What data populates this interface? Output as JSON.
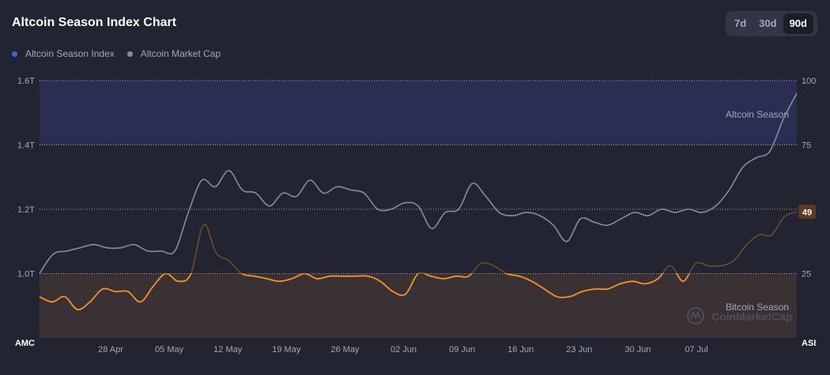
{
  "header": {
    "title": "Altcoin Season Index Chart"
  },
  "range_options": [
    {
      "label": "7d",
      "active": false
    },
    {
      "label": "30d",
      "active": false
    },
    {
      "label": "90d",
      "active": true
    }
  ],
  "legend": [
    {
      "label": "Altcoin Season Index",
      "color": "#3861fb"
    },
    {
      "label": "Altcoin Market Cap",
      "color": "#858ca2"
    }
  ],
  "watermark": "CoinMarketCap",
  "chart_data": {
    "type": "line",
    "x_ticks": [
      "28 Apr",
      "05 May",
      "12 May",
      "19 May",
      "26 May",
      "02 Jun",
      "09 Jun",
      "16 Jun",
      "23 Jun",
      "30 Jun",
      "07 Jul"
    ],
    "left_axis": {
      "label": "AMC",
      "ticks": [
        "1.0T",
        "1.2T",
        "1.4T",
        "1.6T"
      ],
      "tick_values": [
        1.0,
        1.2,
        1.4,
        1.6
      ],
      "unit": "T",
      "ylim": [
        0.8,
        1.6
      ]
    },
    "right_axis": {
      "label": "ASI",
      "ticks": [
        "25",
        "50",
        "75",
        "100"
      ],
      "tick_values": [
        25,
        50,
        75,
        100
      ],
      "ylim": [
        0,
        100
      ]
    },
    "zones": [
      {
        "label": "Altcoin Season",
        "from": 75,
        "to": 100,
        "color": "#2b2e52"
      },
      {
        "label": "Bitcoin Season",
        "from": 0,
        "to": 25,
        "color": "#3a3135"
      }
    ],
    "current_value": "49",
    "series": [
      {
        "name": "Altcoin Market Cap",
        "axis": "left",
        "color": "#858ca2",
        "values": [
          1.0,
          1.06,
          1.07,
          1.08,
          1.09,
          1.08,
          1.08,
          1.09,
          1.07,
          1.07,
          1.07,
          1.19,
          1.29,
          1.27,
          1.32,
          1.26,
          1.25,
          1.21,
          1.25,
          1.24,
          1.29,
          1.25,
          1.27,
          1.26,
          1.25,
          1.2,
          1.2,
          1.22,
          1.21,
          1.14,
          1.19,
          1.2,
          1.28,
          1.24,
          1.19,
          1.18,
          1.19,
          1.18,
          1.15,
          1.1,
          1.17,
          1.16,
          1.15,
          1.17,
          1.19,
          1.18,
          1.2,
          1.19,
          1.2,
          1.19,
          1.21,
          1.26,
          1.33,
          1.36,
          1.38,
          1.48,
          1.56
        ]
      },
      {
        "name": "Altcoin Season Index",
        "axis": "right",
        "color": "#f7931a",
        "values": [
          16,
          14,
          16,
          11,
          14,
          19,
          18,
          18,
          14,
          20,
          25,
          22,
          25,
          44,
          33,
          30,
          25,
          24,
          23,
          22,
          23,
          25,
          23,
          24,
          24,
          24,
          24,
          22,
          18,
          17,
          25,
          24,
          23,
          24,
          24,
          29,
          28,
          25,
          24,
          22,
          19,
          16,
          16,
          18,
          19,
          19,
          21,
          22,
          21,
          23,
          28,
          22,
          29,
          28,
          28,
          30,
          36,
          40,
          40,
          47,
          49
        ]
      }
    ]
  }
}
